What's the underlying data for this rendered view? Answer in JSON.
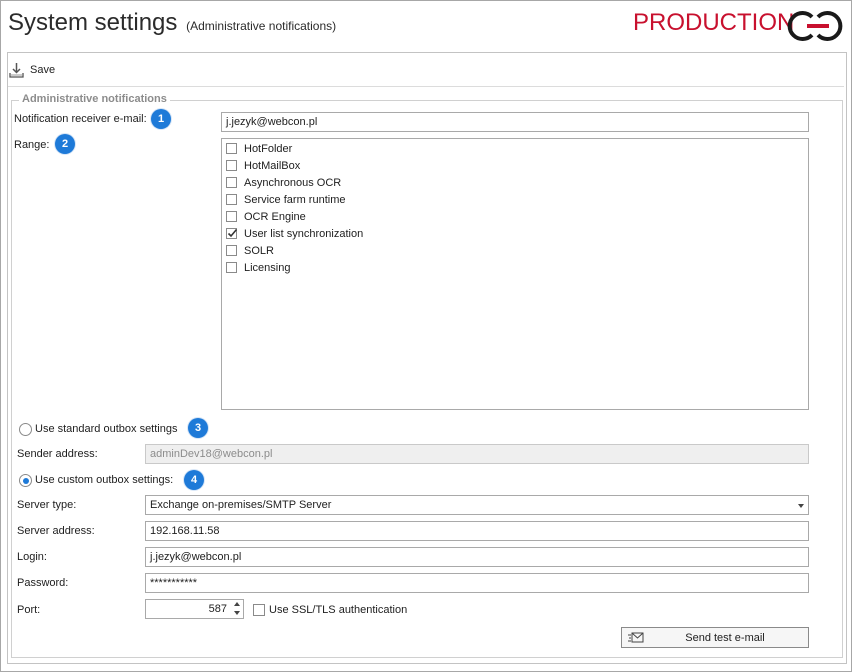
{
  "header": {
    "title": "System settings",
    "subtitle": "(Administrative notifications)",
    "environment": "PRODUCTION",
    "environment_color": "#c8102e"
  },
  "toolbar": {
    "save_icon": "save-download-icon",
    "save_label": "Save"
  },
  "group": {
    "legend": "Administrative notifications"
  },
  "notification": {
    "email_label": "Notification receiver e-mail:",
    "email_badge": "1",
    "email_value": "j.jezyk@webcon.pl",
    "range_label": "Range:",
    "range_badge": "2",
    "range_items": [
      {
        "label": "HotFolder",
        "checked": false
      },
      {
        "label": "HotMailBox",
        "checked": false
      },
      {
        "label": "Asynchronous OCR",
        "checked": false
      },
      {
        "label": "Service farm runtime",
        "checked": false
      },
      {
        "label": "OCR Engine",
        "checked": false
      },
      {
        "label": "User list synchronization",
        "checked": true
      },
      {
        "label": "SOLR",
        "checked": false
      },
      {
        "label": "Licensing",
        "checked": false
      }
    ]
  },
  "outbox": {
    "standard_label": "Use standard outbox settings",
    "standard_badge": "3",
    "standard_selected": false,
    "sender_label": "Sender address:",
    "sender_value": "adminDev18@webcon.pl",
    "custom_label": "Use custom outbox settings:",
    "custom_badge": "4",
    "custom_selected": true,
    "server_type_label": "Server type:",
    "server_type_value": "Exchange on-premises/SMTP Server",
    "server_address_label": "Server address:",
    "server_address_value": "192.168.11.58",
    "login_label": "Login:",
    "login_value": "j.jezyk@webcon.pl",
    "password_label": "Password:",
    "password_value": "***********",
    "port_label": "Port:",
    "port_value": "587",
    "ssl_label": "Use SSL/TLS authentication",
    "ssl_checked": false,
    "send_test_icon": "send-email-icon",
    "send_test_label": "Send test e-mail"
  },
  "colors": {
    "accent": "#1e7ad8",
    "brand": "#c8102e"
  }
}
